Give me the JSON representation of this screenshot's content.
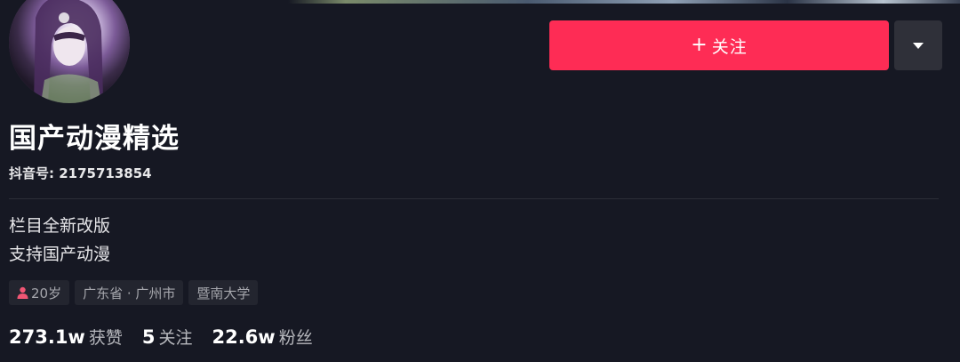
{
  "profile": {
    "name": "国产动漫精选",
    "douyin_id": "抖音号: 2175713854",
    "bio_lines": [
      "栏目全新改版",
      "支持国产动漫"
    ]
  },
  "actions": {
    "follow_plus": "+",
    "follow_label": "关注",
    "more_icon": "caret-down-icon"
  },
  "tags": {
    "age": "20岁",
    "location": "广东省 · 广州市",
    "school": "暨南大学",
    "age_icon": "person-icon"
  },
  "stats": {
    "likes_num": "273.1w",
    "likes_label": "获赞",
    "following_num": "5",
    "following_label": "关注",
    "followers_num": "22.6w",
    "followers_label": "粉丝"
  },
  "colors": {
    "background": "#161823",
    "accent": "#fe2c55",
    "secondary_button": "#2f3039",
    "tag_background": "#23252f",
    "age_icon_color": "#f05674"
  }
}
